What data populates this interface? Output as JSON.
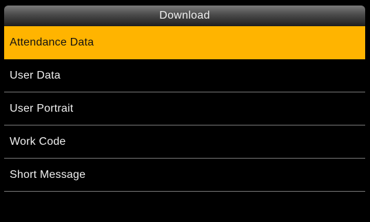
{
  "window": {
    "title": "Download"
  },
  "menu": {
    "items": [
      {
        "label": "Attendance Data",
        "selected": true
      },
      {
        "label": "User Data",
        "selected": false
      },
      {
        "label": "User Portrait",
        "selected": false
      },
      {
        "label": "Work Code",
        "selected": false
      },
      {
        "label": "Short Message",
        "selected": false
      }
    ]
  },
  "colors": {
    "highlight": "#ffb400",
    "background": "#000000",
    "text": "#f0f0f0",
    "divider": "#7a7a7a"
  }
}
